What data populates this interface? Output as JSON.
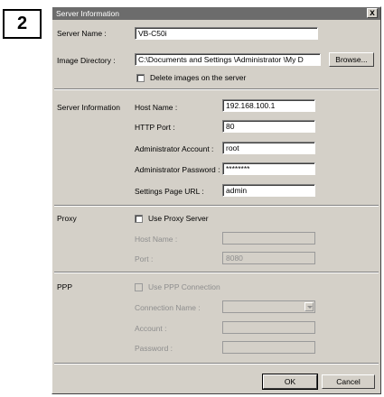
{
  "step_number": "2",
  "dialog": {
    "title": "Server Information",
    "close": "x"
  },
  "general": {
    "server_name_label": "Server Name :",
    "server_name_value": "VB-C50i",
    "image_directory_label": "Image Directory :",
    "image_directory_value": "C:\\Documents and Settings \\Administrator \\My D",
    "browse_label": "Browse...",
    "delete_images_label": "Delete images on the server",
    "delete_images_checked": false
  },
  "server_info": {
    "section_label": "Server Information",
    "host_name_label": "Host Name :",
    "host_name_value": "192.168.100.1",
    "http_port_label": "HTTP Port :",
    "http_port_value": "80",
    "admin_account_label": "Administrator Account :",
    "admin_account_value": "root",
    "admin_password_label": "Administrator Password :",
    "admin_password_value": "********",
    "settings_url_label": "Settings Page URL :",
    "settings_url_value": "admin"
  },
  "proxy": {
    "section_label": "Proxy",
    "use_proxy_label": "Use Proxy Server",
    "use_proxy_checked": false,
    "host_name_label": "Host Name :",
    "host_name_value": "",
    "port_label": "Port :",
    "port_value": "8080"
  },
  "ppp": {
    "section_label": "PPP",
    "use_ppp_label": "Use PPP Connection",
    "use_ppp_checked": false,
    "connection_name_label": "Connection Name :",
    "connection_name_value": "",
    "account_label": "Account :",
    "account_value": "",
    "password_label": "Password :",
    "password_value": ""
  },
  "buttons": {
    "ok": "OK",
    "cancel": "Cancel"
  }
}
